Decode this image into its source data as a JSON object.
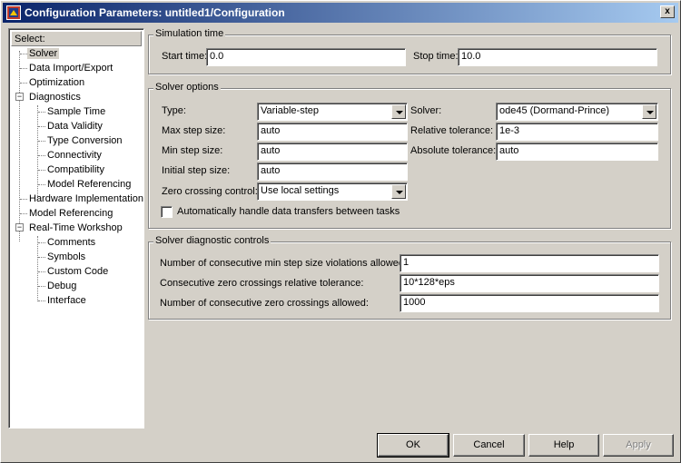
{
  "window": {
    "title": "Configuration Parameters: untitled1/Configuration",
    "close_label": "x"
  },
  "tree": {
    "header": "Select:",
    "items": [
      {
        "label": "Solver"
      },
      {
        "label": "Data Import/Export"
      },
      {
        "label": "Optimization"
      },
      {
        "label": "Diagnostics"
      },
      {
        "label": "Sample Time"
      },
      {
        "label": "Data Validity"
      },
      {
        "label": "Type Conversion"
      },
      {
        "label": "Connectivity"
      },
      {
        "label": "Compatibility"
      },
      {
        "label": "Model Referencing"
      },
      {
        "label": "Hardware Implementation"
      },
      {
        "label": "Model Referencing"
      },
      {
        "label": "Real-Time Workshop"
      },
      {
        "label": "Comments"
      },
      {
        "label": "Symbols"
      },
      {
        "label": "Custom Code"
      },
      {
        "label": "Debug"
      },
      {
        "label": "Interface"
      }
    ],
    "selected": "Solver"
  },
  "simulation_time": {
    "title": "Simulation time",
    "start_label": "Start time:",
    "start_value": "0.0",
    "stop_label": "Stop time:",
    "stop_value": "10.0"
  },
  "solver_options": {
    "title": "Solver options",
    "type_label": "Type:",
    "type_value": "Variable-step",
    "solver_label": "Solver:",
    "solver_value": "ode45 (Dormand-Prince)",
    "max_step_label": "Max step size:",
    "max_step_value": "auto",
    "rel_tol_label": "Relative tolerance:",
    "rel_tol_value": "1e-3",
    "min_step_label": "Min step size:",
    "min_step_value": "auto",
    "abs_tol_label": "Absolute tolerance:",
    "abs_tol_value": "auto",
    "init_step_label": "Initial step size:",
    "init_step_value": "auto",
    "zero_cross_label": "Zero crossing control:",
    "zero_cross_value": "Use local settings",
    "auto_transfer_label": "Automatically handle data transfers between tasks",
    "auto_transfer_checked": false
  },
  "diagnostic_controls": {
    "title": "Solver diagnostic controls",
    "min_step_violations_label": "Number of consecutive min step size violations allowed:",
    "min_step_violations_value": "1",
    "zc_rel_tol_label": "Consecutive zero crossings relative tolerance:",
    "zc_rel_tol_value": "10*128*eps",
    "zc_allowed_label": "Number of consecutive zero crossings allowed:",
    "zc_allowed_value": "1000"
  },
  "buttons": {
    "ok": "OK",
    "cancel": "Cancel",
    "help": "Help",
    "apply": "Apply"
  },
  "colors": {
    "titlebar_start": "#0a246a",
    "titlebar_end": "#a6caf0",
    "face": "#d4d0c8"
  }
}
